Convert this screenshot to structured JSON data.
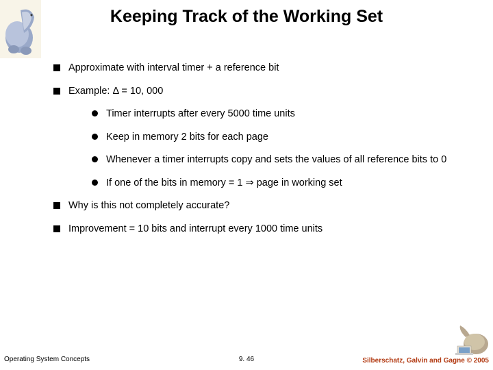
{
  "title": "Keeping Track of the Working Set",
  "bullets": {
    "b1": "Approximate with interval timer + a reference bit",
    "b2_pre": "Example: ",
    "b2_post": " = 10, 000",
    "s1": "Timer interrupts after every 5000 time units",
    "s2": "Keep in memory 2 bits for each page",
    "s3": "Whenever a timer interrupts copy and sets the values of all reference bits to 0",
    "s4_pre": "If one of the bits in memory = 1 ",
    "s4_post": " page in working set",
    "b3": "Why is this not completely accurate?",
    "b4": " Improvement = 10 bits and interrupt every 1000 time units"
  },
  "symbols": {
    "delta": "Δ",
    "implies": "⇒"
  },
  "footer": {
    "left": "Operating System Concepts",
    "center": "9. 46",
    "right": "Silberschatz, Galvin and Gagne © 2005"
  }
}
